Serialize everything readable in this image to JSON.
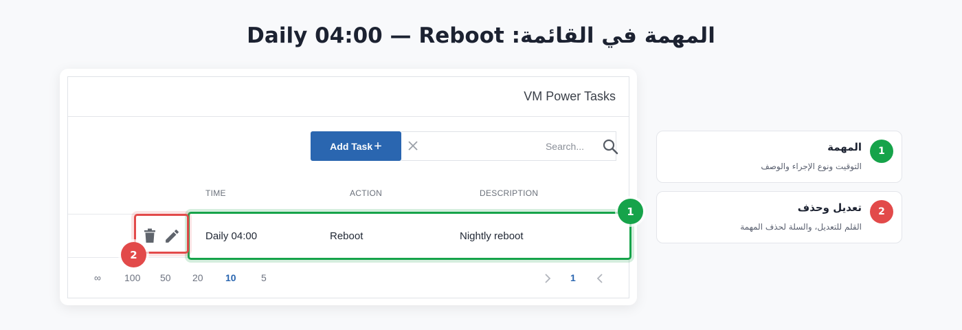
{
  "page": {
    "title": "المهمة في القائمة: Daily 04:00 — Reboot"
  },
  "panel": {
    "title": "VM Power Tasks",
    "add_button": {
      "label": "Add Task",
      "icon": "plus-icon"
    },
    "search": {
      "placeholder": "Search...",
      "clear_icon": "close-icon",
      "icon": "search-icon"
    },
    "columns": [
      "TIME",
      "ACTION",
      "DESCRIPTION"
    ],
    "rows": [
      {
        "time": "Daily 04:00",
        "action": "Reboot",
        "description": "Nightly reboot",
        "icons": [
          "trash-icon",
          "edit-icon"
        ]
      }
    ],
    "pager": {
      "page_sizes": [
        "∞",
        "100",
        "50",
        "20",
        "10",
        "5"
      ],
      "selected_size": "10",
      "current_page": "1"
    }
  },
  "callouts": [
    {
      "number": "1",
      "title": "المهمة",
      "desc": "التوقيت ونوع الإجراء والوصف",
      "color": "#16a34a"
    },
    {
      "number": "2",
      "title": "تعديل وحذف",
      "desc": "القلم للتعديل، والسلة لحذف المهمة",
      "color": "#e24a4a"
    }
  ],
  "colors": {
    "accent": "#2a66b0",
    "highlight_green": "#16a34a",
    "highlight_red": "#e24a4a"
  }
}
